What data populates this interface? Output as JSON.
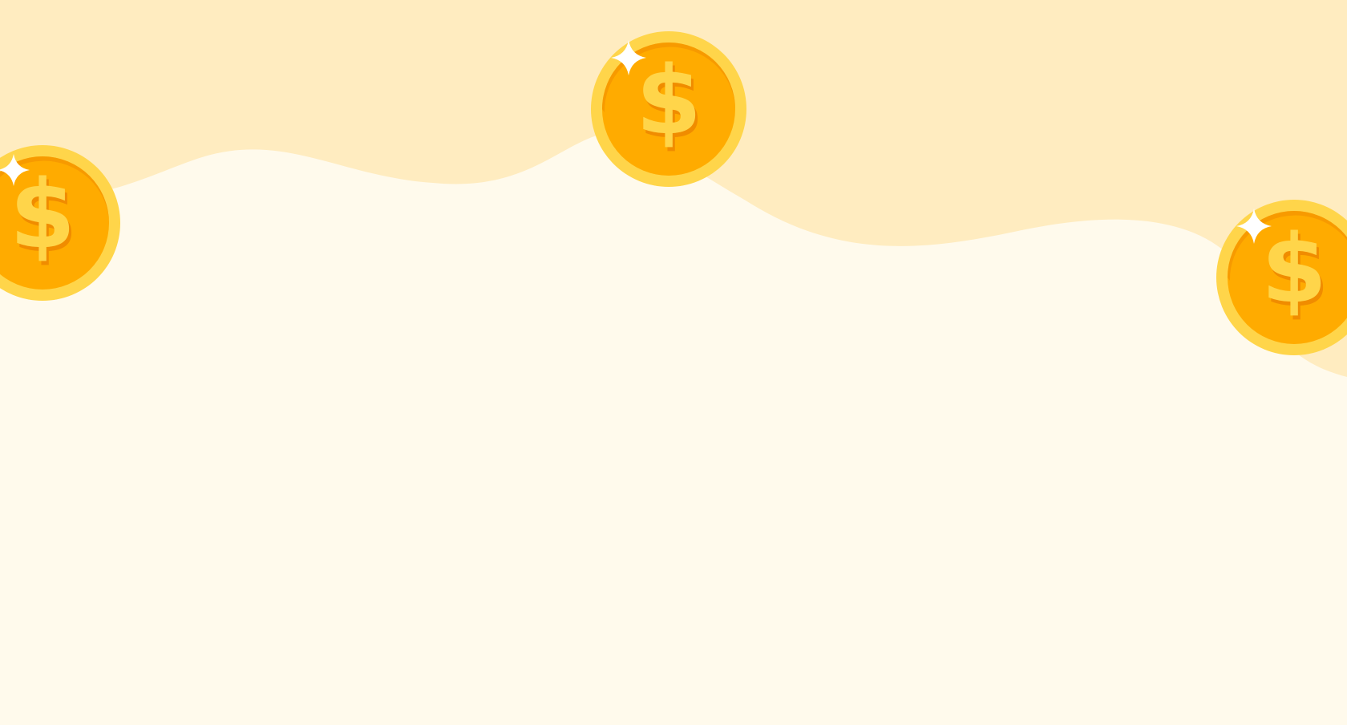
{
  "scene": {
    "description_free": true,
    "colors": {
      "band": "#ffecc0",
      "background": "#fffaec",
      "coin_rim": "#ffd54a",
      "coin_face": "#ffab00",
      "coin_shadow": "#f08c00",
      "symbol_fill": "#ffd54a",
      "sparkle": "#ffffff"
    },
    "coins": [
      {
        "icon": "dollar-coin-icon",
        "symbol": "$"
      },
      {
        "icon": "dollar-coin-icon",
        "symbol": "$"
      },
      {
        "icon": "dollar-coin-icon",
        "symbol": "$"
      }
    ]
  }
}
